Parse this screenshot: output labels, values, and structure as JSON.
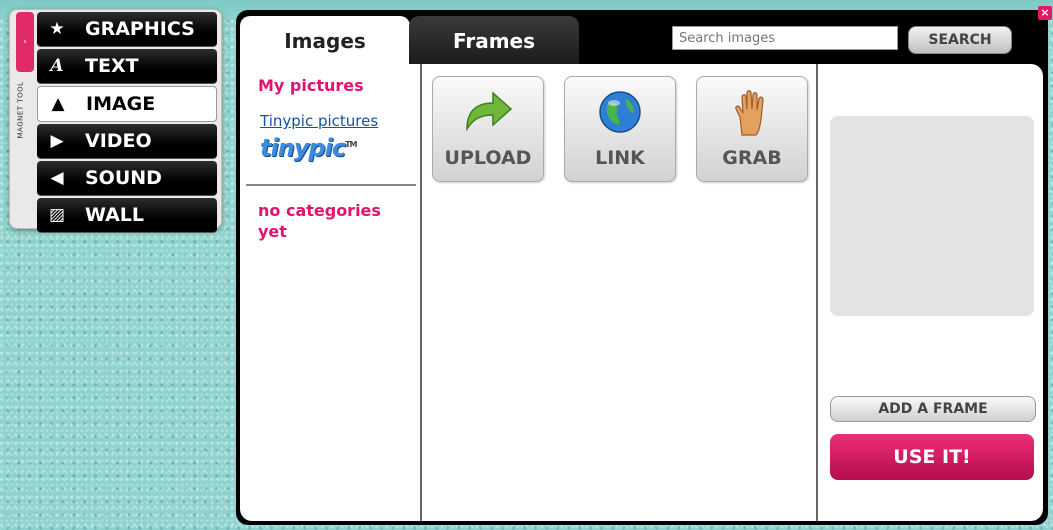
{
  "tool_panel": {
    "tab_glyph": "‹",
    "vertical_label": "MAGNET TOOL",
    "items": [
      {
        "label": "GRAPHICS",
        "icon": "star-icon",
        "glyph": "★"
      },
      {
        "label": "TEXT",
        "icon": "text-icon",
        "glyph": "A"
      },
      {
        "label": "IMAGE",
        "icon": "image-icon",
        "glyph": "▲",
        "active": true
      },
      {
        "label": "VIDEO",
        "icon": "video-icon",
        "glyph": "▶"
      },
      {
        "label": "SOUND",
        "icon": "speaker-icon",
        "glyph": "◀"
      },
      {
        "label": "WALL",
        "icon": "wall-icon",
        "glyph": "▨"
      }
    ]
  },
  "dialog": {
    "close_glyph": "×",
    "tabs": {
      "images": "Images",
      "frames": "Frames"
    },
    "search": {
      "placeholder": "Search images",
      "button": "SEARCH"
    },
    "left": {
      "my_pictures": "My pictures",
      "tinypic_link": "Tinypic pictures",
      "tinypic_logo": "tinypic",
      "tinypic_tm": "TM",
      "no_categories": "no categories yet"
    },
    "sources": {
      "upload": "UPLOAD",
      "link": "LINK",
      "grab": "GRAB"
    },
    "right": {
      "add_frame": "ADD A FRAME",
      "use_it": "USE IT!"
    }
  },
  "colors": {
    "accent_pink": "#e0136f",
    "button_pink": "#d41b62",
    "background": "#8fd3cf"
  }
}
